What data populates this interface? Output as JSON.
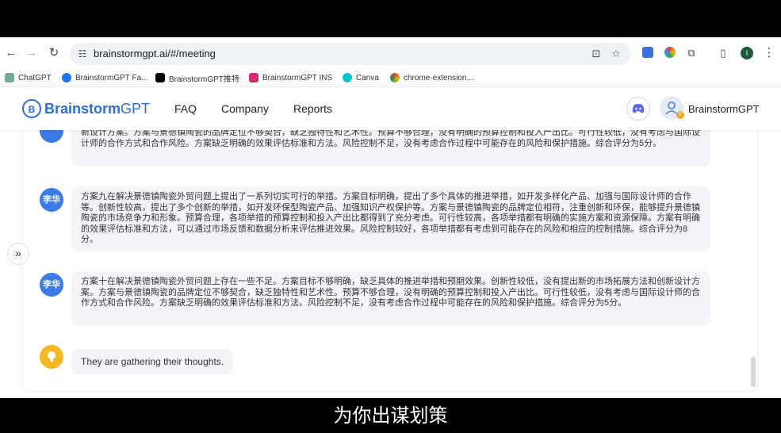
{
  "browser": {
    "url": "brainstormgpt.ai/#/meeting",
    "profile_initial": "I",
    "bookmarks": [
      {
        "label": "ChatGPT",
        "color": "#74aa9c"
      },
      {
        "label": "BrainstormGPT Fa...",
        "color": "#1877f2"
      },
      {
        "label": "BrainstormGPT推特",
        "color": "#000000"
      },
      {
        "label": "BrainstormGPT INS",
        "color": "#d62976"
      },
      {
        "label": "Canva",
        "color": "#00c4cc"
      },
      {
        "label": "chrome-extension...",
        "color": "#db4437"
      }
    ]
  },
  "site": {
    "logo_bold": "Brainstorm",
    "logo_light": "GPT",
    "nav": [
      "FAQ",
      "Company",
      "Reports"
    ],
    "user_name": "BrainstormGPT"
  },
  "messages": [
    {
      "avatar": "",
      "text": "新设计方案。方案与景德镇陶瓷的品牌定位不够契合，缺乏独特性和艺术性。预算不够合理，没有明确的预算控制和投入产出比。可行性较低，没有考虑与国际设计师的合作方式和合作风险。方案缺乏明确的效果评估标准和方法。风险控制不足，没有考虑合作过程中可能存在的风险和保护措施。综合评分为5分。"
    },
    {
      "avatar": "李华",
      "text": "方案九在解决景德镇陶瓷外贸问题上提出了一系列切实可行的举措。方案目标明确，提出了多个具体的推进举措，如开发多样化产品、加强与国际设计师的合作等。创新性较高，提出了多个创新的举措，如开发环保型陶瓷产品、加强知识产权保护等。方案与景德镇陶瓷的品牌定位相符，注重创新和环保，能够提升景德镇陶瓷的市场竞争力和形象。预算合理，各项举措的预算控制和投入产出比都得到了充分考虑。可行性较高，各项举措都有明确的实施方案和资源保障。方案有明确的效果评估标准和方法，可以通过市场反馈和数据分析来评估推进效果。风险控制较好，各项举措都有考虑到可能存在的风险和相应的控制措施。综合评分为8分。"
    },
    {
      "avatar": "李华",
      "text": "方案十在解决景德镇陶瓷外贸问题上存在一些不足。方案目标不够明确，缺乏具体的推进举措和预期效果。创新性较低，没有提出新的市场拓展方法和创新设计方案。方案与景德镇陶瓷的品牌定位不够契合，缺乏独特性和艺术性。预算不够合理，没有明确的预算控制和投入产出比。可行性较低，没有考虑与国际设计师的合作方式和合作风险。方案缺乏明确的效果评估标准和方法。风险控制不足，没有考虑合作过程中可能存在的风险和保护措施。综合评分为5分。"
    }
  ],
  "status_message": "They are gathering their thoughts.",
  "expand_glyph": "»",
  "subtitle": "为你出谋划策"
}
